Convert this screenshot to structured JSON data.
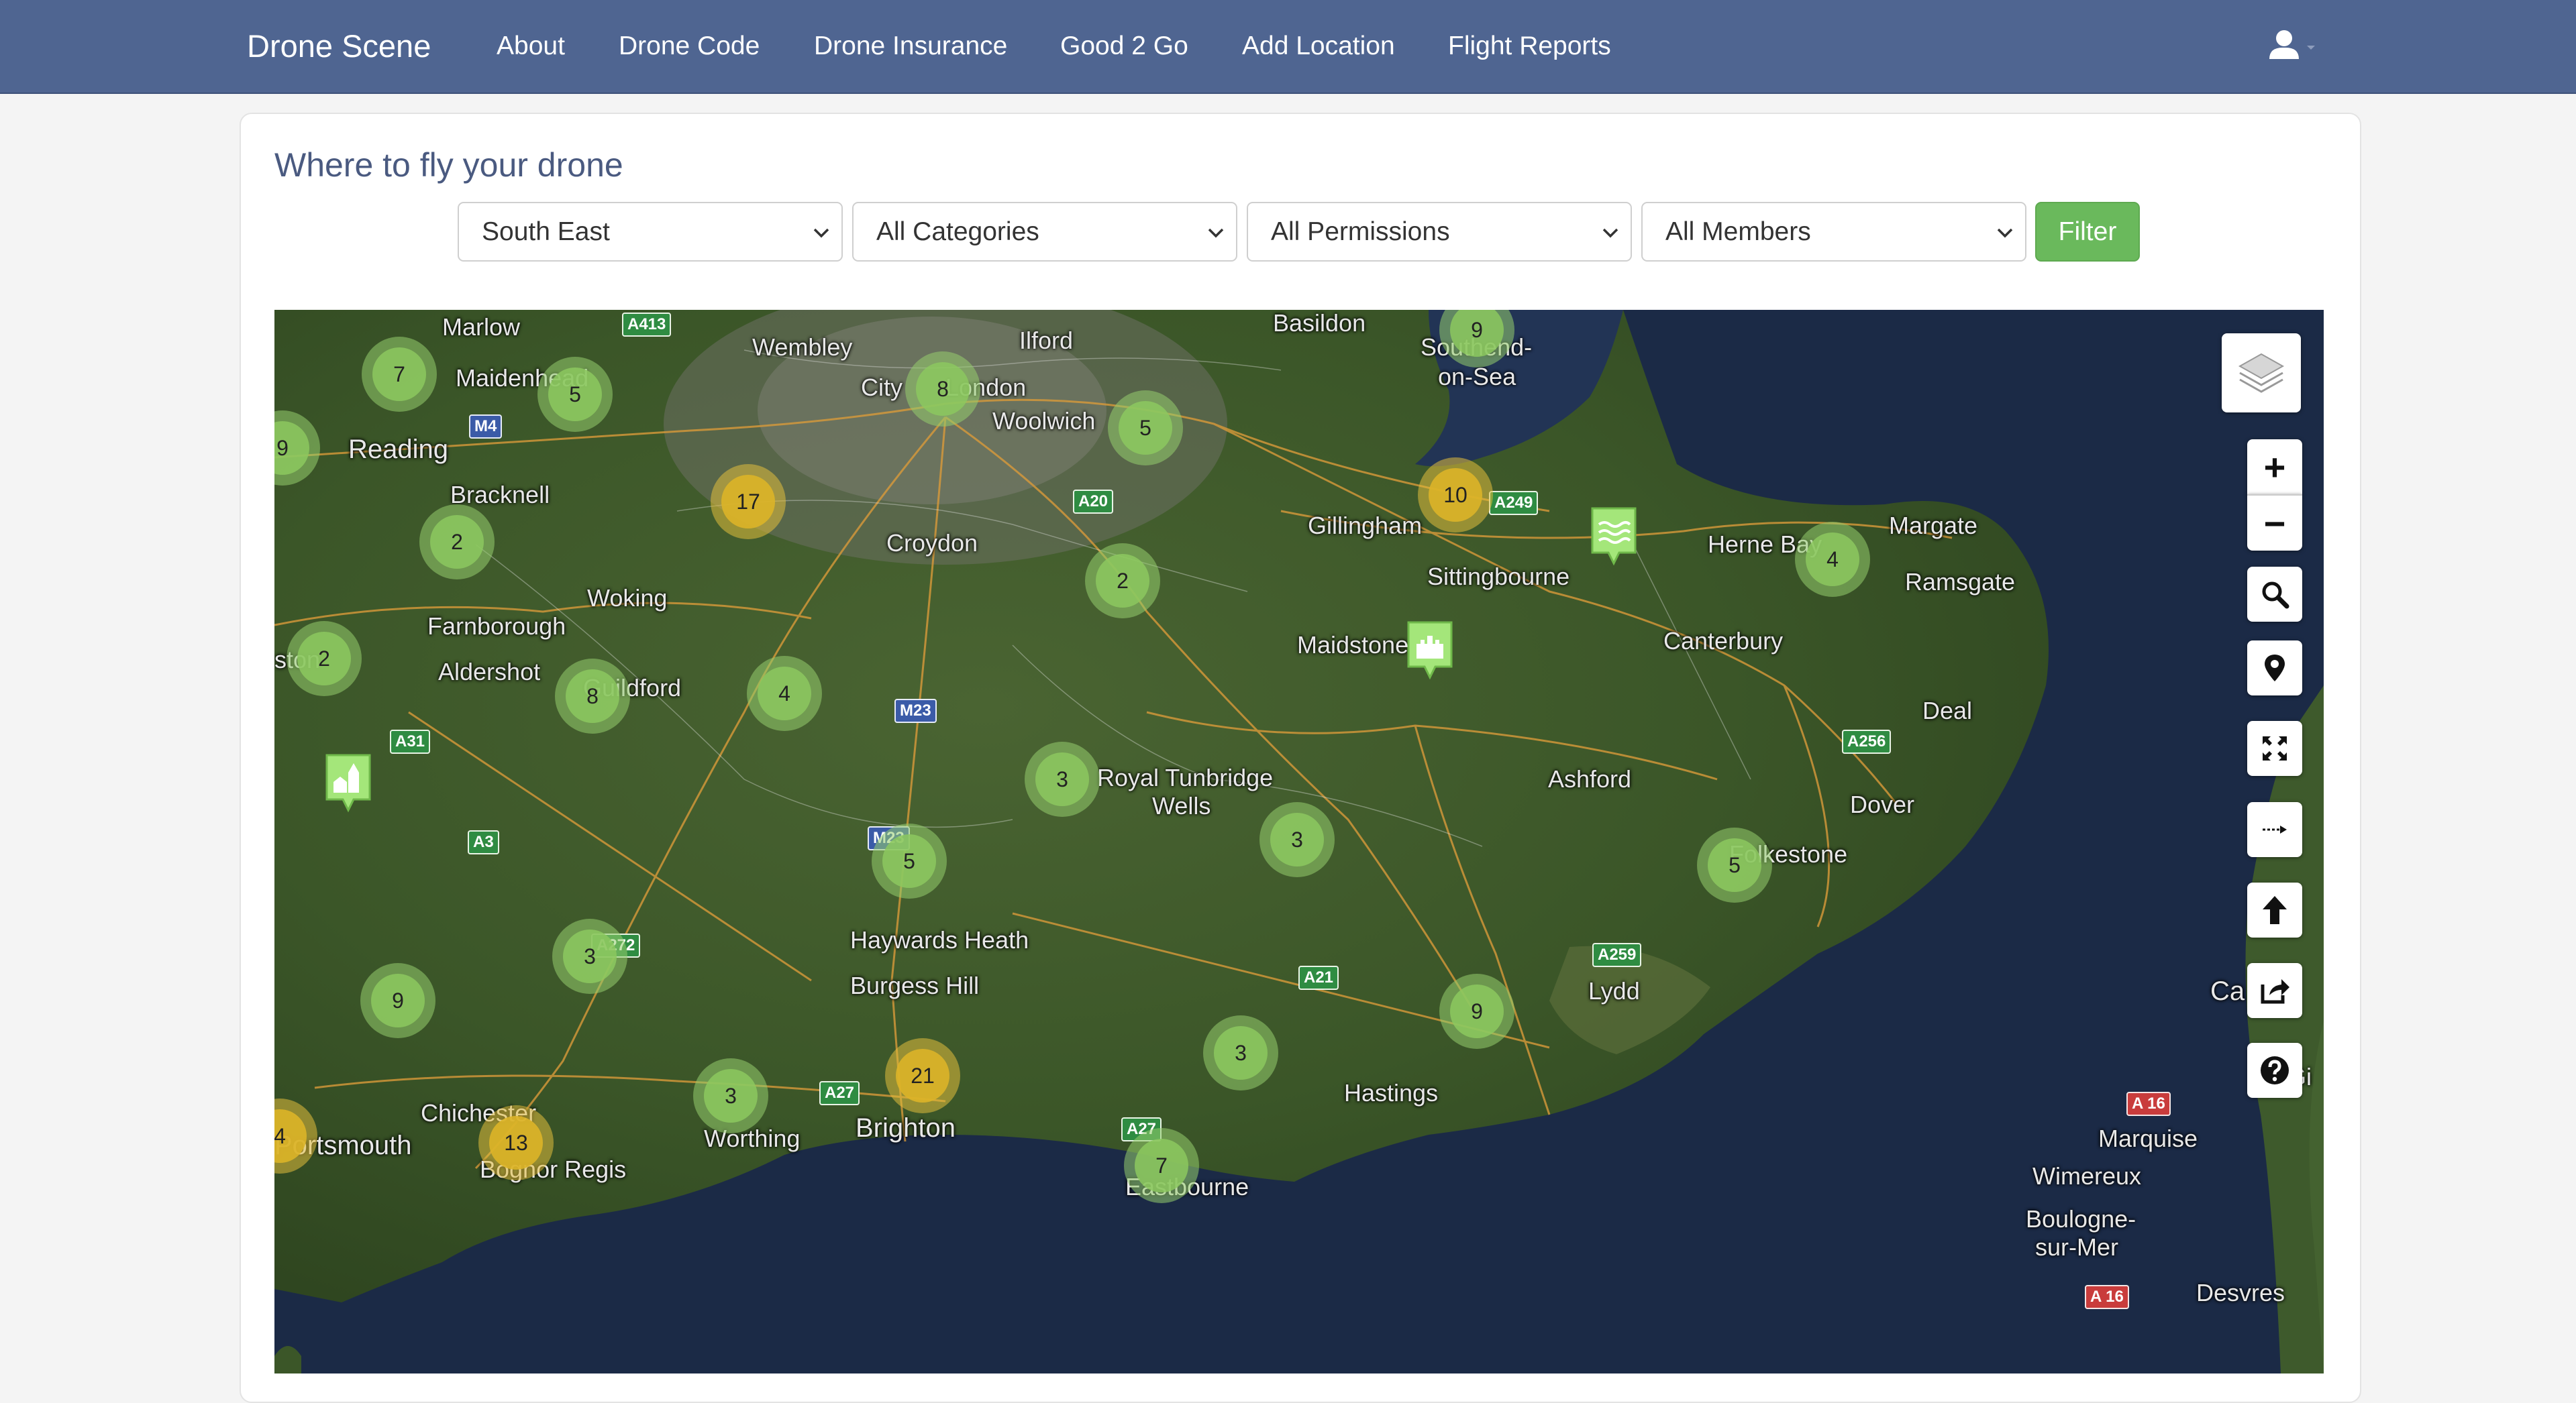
{
  "navbar": {
    "brand": "Drone Scene",
    "links": [
      "About",
      "Drone Code",
      "Drone Insurance",
      "Good 2 Go",
      "Add Location",
      "Flight Reports"
    ],
    "user_icon": "user-icon"
  },
  "page": {
    "title": "Where to fly your drone"
  },
  "filters": {
    "region": "South East",
    "category": "All Categories",
    "permissions": "All Permissions",
    "members": "All Members",
    "button": "Filter"
  },
  "map": {
    "places": [
      "Marlow",
      "Maidenhead",
      "Wembley",
      "City",
      "London",
      "Ilford",
      "Woolwich",
      "Basildon",
      "Southend-",
      "on-Sea",
      "Reading",
      "Bracknell",
      "Croydon",
      "Gillingham",
      "Herne Bay",
      "Margate",
      "Ramsgate",
      "Sittingbourne",
      "Woking",
      "Farnborough",
      "Aldershot",
      "Guildford",
      "Maidstone",
      "Canterbury",
      "Deal",
      "Royal Tunbridge",
      "Wells",
      "Ashford",
      "Dover",
      "Folkestone",
      "Haywards Heath",
      "Burgess Hill",
      "Lydd",
      "Hastings",
      "Chichester",
      "Bognor Regis",
      "Worthing",
      "Brighton",
      "Eastbourne",
      "Wimereux",
      "Boulogne-",
      "sur-Mer",
      "Marquise",
      "Desvres",
      "Ca",
      "Gi",
      "Portsmouth",
      "ston"
    ],
    "roads": [
      "A413",
      "M4",
      "A20",
      "A249",
      "M23",
      "A31",
      "A3",
      "M23",
      "A272",
      "A27",
      "A27",
      "A21",
      "A259",
      "A256",
      "A 16",
      "A 16"
    ],
    "clusters": [
      7,
      5,
      8,
      9,
      5,
      9,
      17,
      2,
      10,
      2,
      4,
      2,
      8,
      4,
      3,
      3,
      5,
      5,
      3,
      9,
      21,
      3,
      9,
      3,
      13,
      4,
      7
    ],
    "cluster_levels": [
      "green",
      "green",
      "green",
      "green",
      "green",
      "green",
      "gold",
      "green",
      "gold",
      "green",
      "green",
      "green",
      "green",
      "green",
      "green",
      "green",
      "green",
      "green",
      "green",
      "green",
      "gold",
      "green",
      "green",
      "green",
      "gold",
      "gold",
      "green"
    ],
    "markers": [
      "castle-marker",
      "water-marker",
      "church-marker"
    ],
    "controls": [
      "layers-icon",
      "zoom-in-icon",
      "zoom-out-icon",
      "search-icon",
      "location-pin-icon",
      "fullscreen-icon",
      "measure-icon",
      "upload-arrow-icon",
      "share-icon",
      "help-icon"
    ],
    "zoom_in_label": "+",
    "zoom_out_label": "−"
  },
  "colors": {
    "navbar": "#4f6591",
    "filter_button": "#6ab95c",
    "cluster_green": "#8cc85f",
    "cluster_gold": "#dcb428",
    "sea": "#1b2a46",
    "land": "#3e5a2c"
  }
}
